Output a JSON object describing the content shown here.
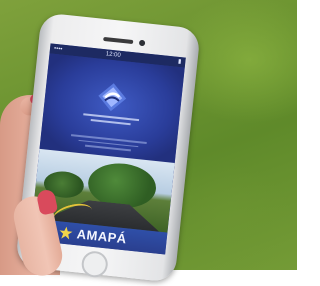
{
  "photo": {
    "subject": "Hand holding smartphone displaying app splash screen over grass background",
    "colors": {
      "background_grass": "#6b9330",
      "phone_frame": "#f0f0f1",
      "screen_primary": "#2a3d9a",
      "accent_yellow": "#e5c33a",
      "nail_polish": "#d4465a"
    }
  },
  "phone": {
    "status_bar": {
      "carrier": "••••",
      "time": "12:00",
      "battery": "▮"
    },
    "app": {
      "logo_icon": "diamond-logo-icon",
      "footer": {
        "state_logo_icon": "star-emblem-icon",
        "state_name": "AMAPÁ"
      }
    }
  }
}
